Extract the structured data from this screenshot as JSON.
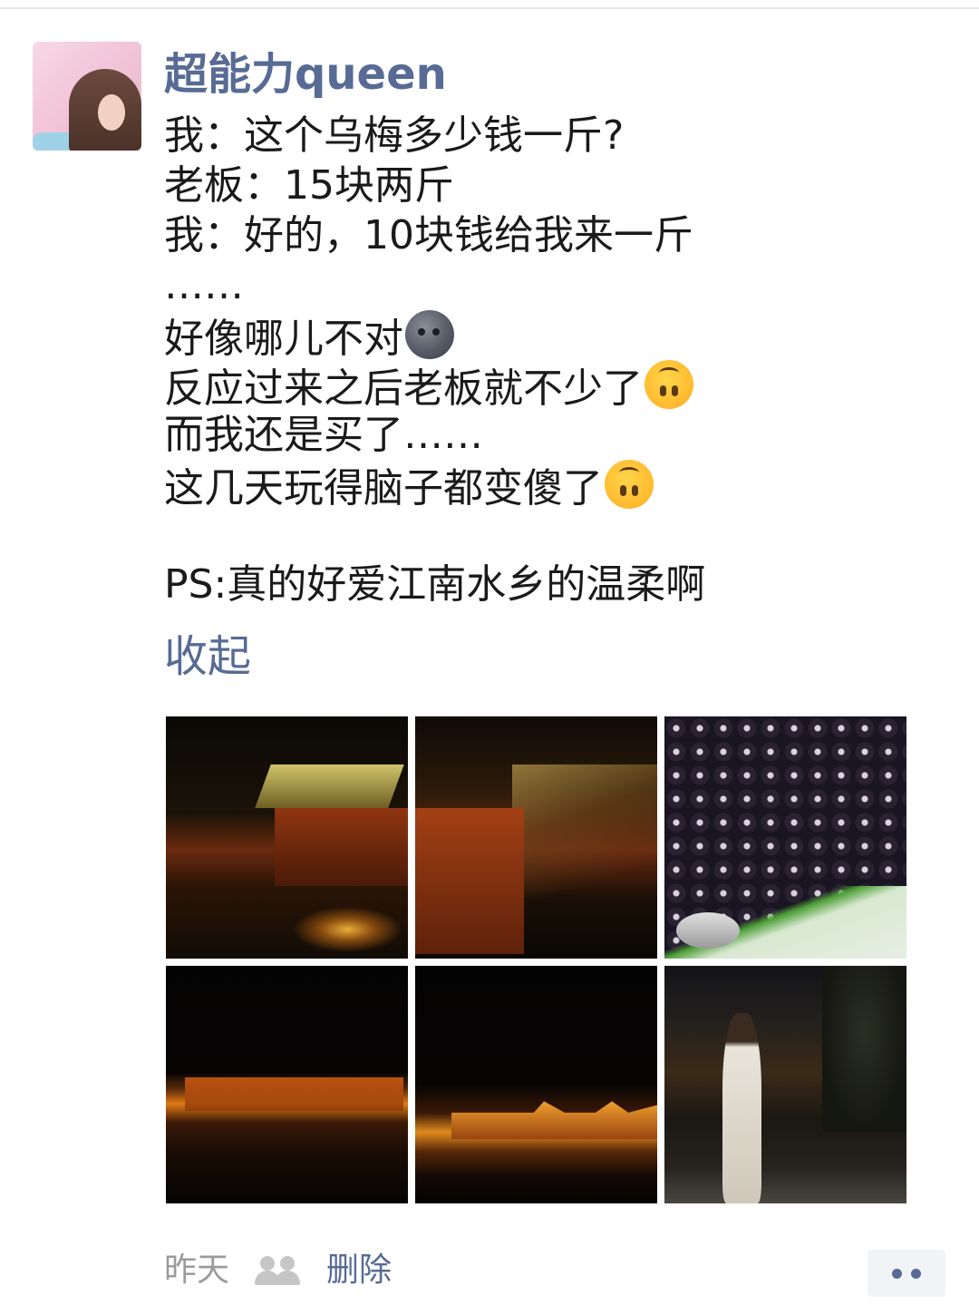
{
  "post": {
    "username": "超能力queen",
    "lines": {
      "l1": "我：这个乌梅多少钱一斤?",
      "l2": "老板：15块两斤",
      "l3": "我：好的，10块钱给我来一斤",
      "l4": "……",
      "l5": "好像哪儿不对",
      "l6": "反应过来之后老板就不少了",
      "l7": "而我还是买了……",
      "l8": "这几天玩得脑子都变傻了",
      "l10": "PS:真的好爱江南水乡的温柔啊"
    },
    "emojis": {
      "l5": "new-moon-face-icon",
      "l6": "upside-down-face-icon",
      "l8": "upside-down-face-icon"
    },
    "collapse_label": "收起",
    "photo_count": 6
  },
  "footer": {
    "timestamp": "昨天",
    "visibility_icon": "group-icon",
    "delete_label": "删除",
    "more_icon": "more-dots-icon"
  },
  "colors": {
    "link": "#576b95",
    "meta": "#9b9b9b",
    "text": "#1a1a1a"
  }
}
